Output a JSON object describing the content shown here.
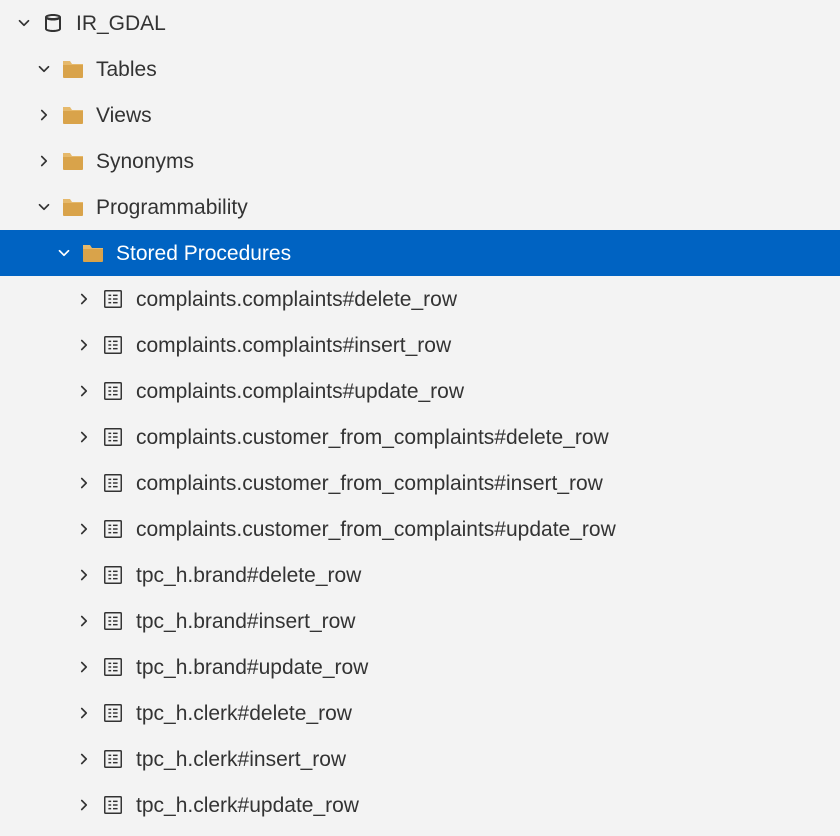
{
  "colors": {
    "selection": "#0063c2",
    "folder": "#d9a34a",
    "background": "#f3f3f3"
  },
  "tree": {
    "root": {
      "label": "IR_GDAL",
      "expanded": true,
      "icon": "database"
    },
    "children": [
      {
        "label": "Tables",
        "expanded": true,
        "icon": "folder"
      },
      {
        "label": "Views",
        "expanded": false,
        "icon": "folder"
      },
      {
        "label": "Synonyms",
        "expanded": false,
        "icon": "folder"
      },
      {
        "label": "Programmability",
        "expanded": true,
        "icon": "folder"
      }
    ],
    "programmability": {
      "stored_procedures": {
        "label": "Stored Procedures",
        "expanded": true,
        "selected": true,
        "icon": "folder"
      },
      "procedures": [
        "complaints.complaints#delete_row",
        "complaints.complaints#insert_row",
        "complaints.complaints#update_row",
        "complaints.customer_from_complaints#delete_row",
        "complaints.customer_from_complaints#insert_row",
        "complaints.customer_from_complaints#update_row",
        "tpc_h.brand#delete_row",
        "tpc_h.brand#insert_row",
        "tpc_h.brand#update_row",
        "tpc_h.clerk#delete_row",
        "tpc_h.clerk#insert_row",
        "tpc_h.clerk#update_row"
      ]
    }
  }
}
